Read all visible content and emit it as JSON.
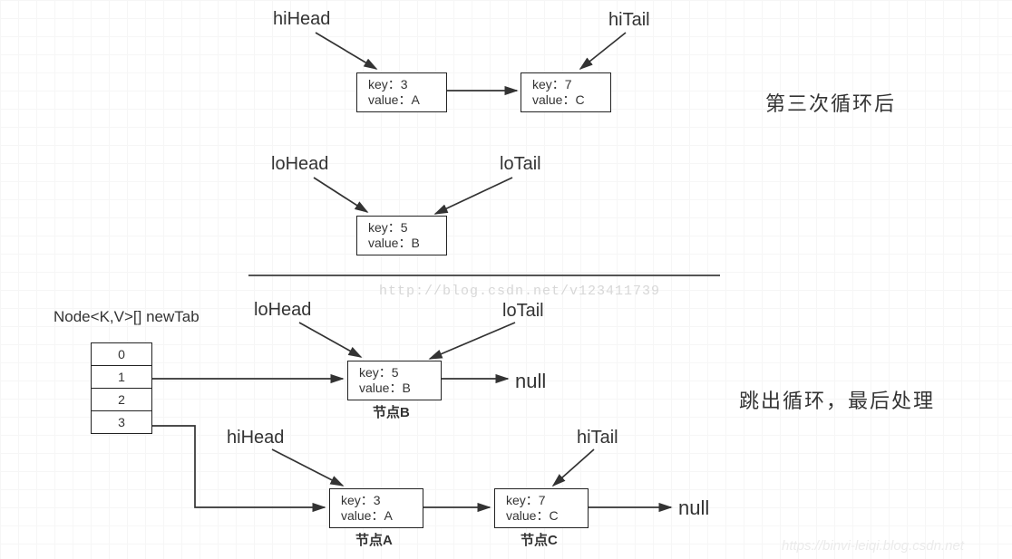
{
  "watermark_top": "http://blog.csdn.net/v123411739",
  "watermark_bottom": "https://binvi-leiqi.blog.csdn.net",
  "section_top": {
    "label_hiHead": "hiHead",
    "label_hiTail": "hiTail",
    "node1": {
      "key": "key：3",
      "val": "value：A"
    },
    "node2": {
      "key": "key：7",
      "val": "value：C"
    },
    "label_loHead": "loHead",
    "label_loTail": "loTail",
    "node3": {
      "key": "key：5",
      "val": "value：B"
    },
    "annotation": "第三次循环后"
  },
  "section_bottom": {
    "newtab_label": "Node<K,V>[] newTab",
    "cells": [
      "0",
      "1",
      "2",
      "3"
    ],
    "label_loHead": "loHead",
    "label_loTail": "loTail",
    "nodeB": {
      "key": "key：5",
      "val": "value：B",
      "caption": "节点B"
    },
    "null1": "null",
    "label_hiHead": "hiHead",
    "label_hiTail": "hiTail",
    "nodeA": {
      "key": "key：3",
      "val": "value：A",
      "caption": "节点A"
    },
    "nodeC": {
      "key": "key：7",
      "val": "value：C",
      "caption": "节点C"
    },
    "null2": "null",
    "annotation": "跳出循环，最后处理"
  }
}
